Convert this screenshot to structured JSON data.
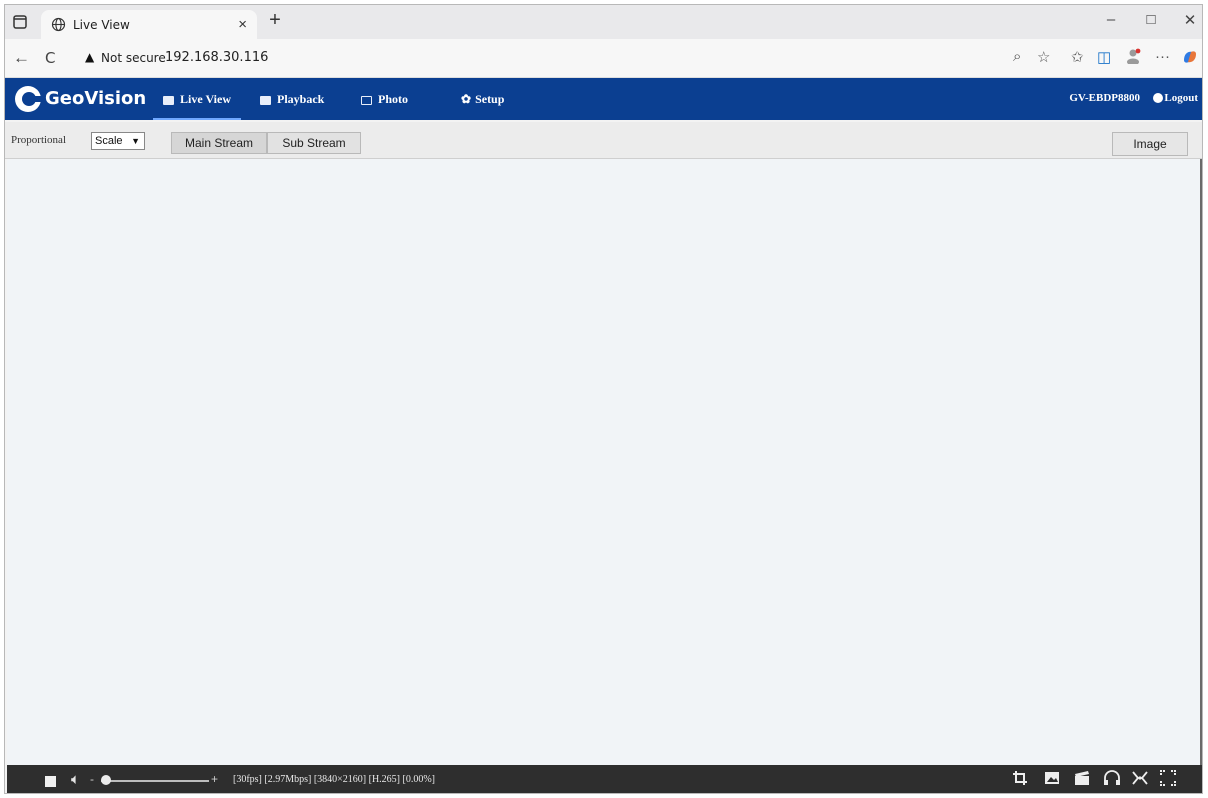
{
  "browser": {
    "tab_title": "Live View",
    "new_tab_symbol": "+",
    "tab_close_symbol": "×",
    "window_controls": {
      "minimize": "–",
      "maximize": "□",
      "close": "✕"
    },
    "address": {
      "security_warning": "Not secure",
      "url": "192.168.30.116"
    },
    "nav": {
      "back": "←",
      "reload": "C"
    }
  },
  "app": {
    "brand": "GeoVision",
    "nav_items": [
      {
        "label": "Live View",
        "icon": "monitor-icon",
        "active": true
      },
      {
        "label": "Playback",
        "icon": "film-icon",
        "active": false
      },
      {
        "label": "Photo",
        "icon": "photo-icon",
        "active": false
      },
      {
        "label": "Setup",
        "icon": "gear-icon",
        "active": false
      }
    ],
    "device_model": "GV-EBDP8800",
    "logout_label": "Logout"
  },
  "toolbar": {
    "proportional_label": "Proportional",
    "scale_value": "Scale",
    "main_stream_label": "Main Stream",
    "sub_stream_label": "Sub Stream",
    "image_label": "Image"
  },
  "player": {
    "stream_stats": "[30fps] [2.97Mbps] [3840×2160] [H.265] [0.00%]",
    "volume_minus": "-",
    "volume_plus": "+",
    "volume_level": 0,
    "controls": [
      "crop-icon",
      "snapshot-icon",
      "record-icon",
      "audio-talk-icon",
      "zoom-icon",
      "fullscreen-icon"
    ]
  },
  "colors": {
    "header_bg": "#0b3f91",
    "control_bar_bg": "#2e2e2e",
    "video_bg": "#f1f4f7"
  }
}
